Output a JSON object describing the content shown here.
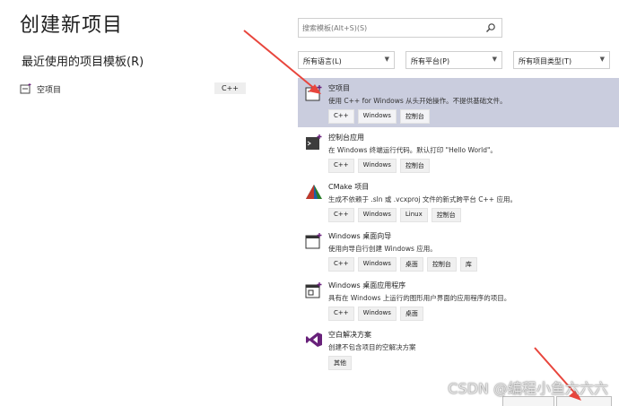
{
  "title": "创建新项目",
  "recent": {
    "heading": "最近使用的项目模板(R)",
    "items": [
      {
        "name": "空项目",
        "lang": "C++"
      }
    ]
  },
  "search": {
    "placeholder": "搜索模板(Alt+S)(S)"
  },
  "filters": {
    "language": "所有语言(L)",
    "platform": "所有平台(P)",
    "project_type": "所有项目类型(T)"
  },
  "templates": [
    {
      "name": "空项目",
      "desc": "使用 C++ for Windows 从头开始操作。不提供基础文件。",
      "tags": [
        "C++",
        "Windows",
        "控制台"
      ],
      "selected": true
    },
    {
      "name": "控制台应用",
      "desc": "在 Windows 终端运行代码。默认打印 \"Hello World\"。",
      "tags": [
        "C++",
        "Windows",
        "控制台"
      ]
    },
    {
      "name": "CMake 项目",
      "desc": "生成不依赖于 .sln 或 .vcxproj 文件的新式跨平台 C++ 应用。",
      "tags": [
        "C++",
        "Windows",
        "Linux",
        "控制台"
      ]
    },
    {
      "name": "Windows 桌面向导",
      "desc": "使用向导自行创建 Windows 应用。",
      "tags": [
        "C++",
        "Windows",
        "桌面",
        "控制台",
        "库"
      ]
    },
    {
      "name": "Windows 桌面应用程序",
      "desc": "具有在 Windows 上运行的图形用户界面的应用程序的项目。",
      "tags": [
        "C++",
        "Windows",
        "桌面"
      ]
    },
    {
      "name": "空白解决方案",
      "desc": "创建不包含项目的空解决方案",
      "tags": [
        "其他"
      ]
    }
  ],
  "watermark": "CSDN @编程小鱼六六六",
  "colors": {
    "selected_bg": "#cacdde",
    "arrow": "#e8453c",
    "purple": "#68217a"
  }
}
